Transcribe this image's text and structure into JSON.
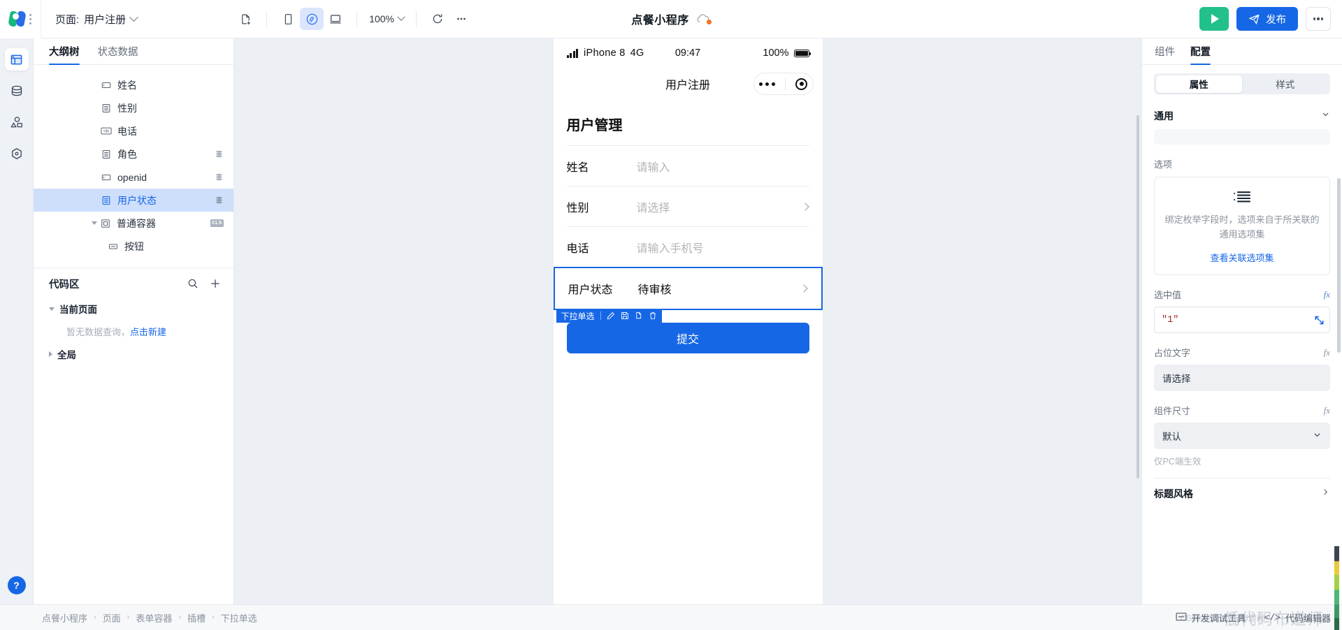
{
  "topbar": {
    "page_prefix": "页面:",
    "page_name": "用户注册",
    "zoom": "100%",
    "app_title": "点餐小程序",
    "run_label": "运行",
    "publish_label": "发布",
    "more_label": "更多",
    "device_icons": [
      "mobile-icon",
      "miniprogram-icon",
      "desktop-icon"
    ],
    "new_page_icon": "new-page-icon",
    "refresh_icon": "refresh-icon",
    "ellipsis_icon": "ellipsis-icon",
    "cloud_icon": "cloud-icon"
  },
  "rail": {
    "items": [
      {
        "name": "layout-icon",
        "active": true
      },
      {
        "name": "database-icon",
        "active": false
      },
      {
        "name": "shapes-icon",
        "active": false
      },
      {
        "name": "plugin-icon",
        "active": false
      }
    ],
    "help_label": "?"
  },
  "left_panel": {
    "tabs": [
      {
        "label": "大纲树",
        "active": true
      },
      {
        "label": "状态数据",
        "active": false
      }
    ],
    "tree": [
      {
        "label": "姓名",
        "icon": "input-field-icon",
        "indent": 2,
        "badge": "",
        "selected": false,
        "caret": ""
      },
      {
        "label": "性别",
        "icon": "select-field-icon",
        "indent": 2,
        "badge": "",
        "selected": false,
        "caret": ""
      },
      {
        "label": "电话",
        "icon": "phone-field-icon",
        "indent": 2,
        "badge": "",
        "selected": false,
        "caret": ""
      },
      {
        "label": "角色",
        "icon": "select-field-icon",
        "indent": 2,
        "badge": "db",
        "selected": false,
        "caret": ""
      },
      {
        "label": "openid",
        "icon": "input-field-icon",
        "indent": 2,
        "badge": "db",
        "selected": false,
        "caret": ""
      },
      {
        "label": "用户状态",
        "icon": "select-field-icon",
        "indent": 2,
        "badge": "db",
        "selected": true,
        "caret": ""
      },
      {
        "label": "普通容器",
        "icon": "container-icon",
        "indent": 1,
        "badge": "CLS",
        "selected": false,
        "caret": "down"
      },
      {
        "label": "按钮",
        "icon": "button-icon",
        "indent": 2,
        "badge": "",
        "selected": false,
        "caret": ""
      }
    ],
    "code_section": {
      "title": "代码区",
      "search_icon": "search-icon",
      "add_icon": "plus-icon",
      "groups": [
        {
          "title": "当前页面",
          "expanded": true,
          "empty_text": "暂无数据查询，",
          "empty_link": "点击新建"
        },
        {
          "title": "全局",
          "expanded": false,
          "empty_text": "",
          "empty_link": ""
        }
      ]
    }
  },
  "phone": {
    "status": {
      "carrier": "iPhone 8",
      "network": "4G",
      "time": "09:47",
      "battery_pct": "100%"
    },
    "nav_title": "用户注册",
    "heading": "用户管理",
    "fields": [
      {
        "label": "姓名",
        "value": "请输入",
        "filled": false,
        "arrow": false,
        "selected": false
      },
      {
        "label": "性别",
        "value": "请选择",
        "filled": false,
        "arrow": true,
        "selected": false
      },
      {
        "label": "电话",
        "value": "请输入手机号",
        "filled": false,
        "arrow": false,
        "selected": false
      },
      {
        "label": "用户状态",
        "value": "待审核",
        "filled": true,
        "arrow": true,
        "selected": true
      }
    ],
    "selection_toolbar": {
      "label": "下拉单选",
      "actions": [
        "edit-icon",
        "save-icon",
        "copy-icon",
        "delete-icon"
      ]
    },
    "submit_label": "提交"
  },
  "right_panel": {
    "tabs": [
      {
        "label": "组件",
        "active": false
      },
      {
        "label": "配置",
        "active": true
      }
    ],
    "segments": [
      {
        "label": "属性",
        "active": true
      },
      {
        "label": "样式",
        "active": false
      }
    ],
    "group": {
      "title": "通用"
    },
    "options": {
      "label": "选项",
      "icon": "list-icon",
      "description": "绑定枚举字段时，选项来自于所关联的通用选项集",
      "link": "查看关联选项集"
    },
    "selected_value": {
      "label": "选中值",
      "fx": "fx",
      "value": "\"1\"",
      "expand_icon": "expand-icon"
    },
    "placeholder_text": {
      "label": "占位文字",
      "fx": "fx",
      "value": "请选择"
    },
    "component_size": {
      "label": "组件尺寸",
      "fx": "fx",
      "value": "默认",
      "hint": "仅PC端生效"
    },
    "title_style": {
      "label": "标题风格",
      "chevron": "chevron-right-icon"
    }
  },
  "bottombar": {
    "breadcrumbs": [
      "点餐小程序",
      "页面",
      "表单容器",
      "插槽",
      "下拉单选"
    ],
    "devtools_label": "开发调试工具",
    "code_editor_label": "代码编辑器",
    "watermark": "低代码布道师",
    "watermark2": "CSDN @低代码布道师"
  }
}
